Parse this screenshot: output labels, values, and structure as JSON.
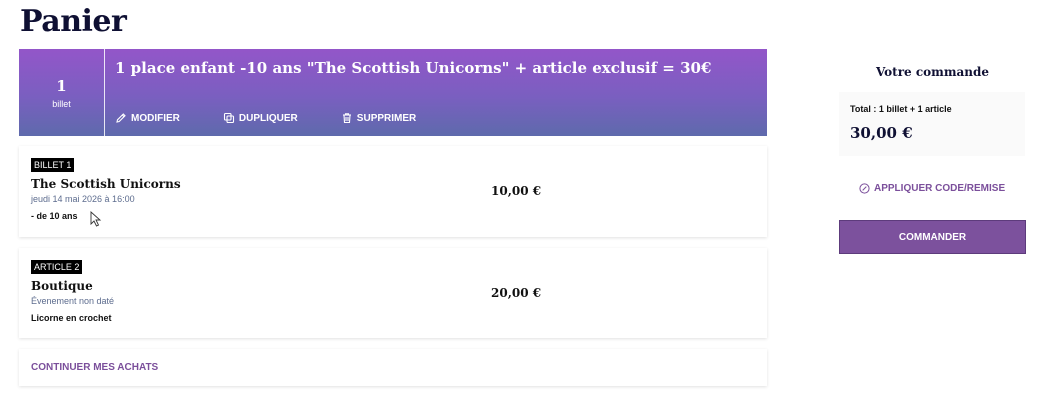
{
  "page": {
    "title": "Panier"
  },
  "cart_header": {
    "quantity": "1",
    "quantity_label": "billet",
    "title": "1 place enfant -10 ans \"The Scottish Unicorns\" + article exclusif = 30€",
    "actions": {
      "edit": "MODIFIER",
      "duplicate": "DUPLIQUER",
      "delete": "SUPPRIMER"
    },
    "gradient_colors": [
      "#9356c9",
      "#5e6aac"
    ]
  },
  "items": [
    {
      "badge": "BILLET 1",
      "name": "The Scottish Unicorns",
      "date": "jeudi 14 mai 2026 à 16:00",
      "extra": "- de 10 ans",
      "price": "10,00 €"
    },
    {
      "badge": "ARTICLE 2",
      "name": "Boutique",
      "date": "Évenement non daté",
      "extra": "Licorne en crochet",
      "price": "20,00 €"
    }
  ],
  "continue_label": "CONTINUER MES ACHATS",
  "order": {
    "title": "Votre commande",
    "total_label": "Total : 1 billet + 1 article",
    "total": "30,00 €",
    "discount_label": "APPLIQUER CODE/REMISE",
    "submit_label": "COMMANDER"
  },
  "icons": {
    "edit": "pencil-icon",
    "duplicate": "copy-icon",
    "delete": "trash-icon",
    "discount": "tag-circle-icon",
    "cursor": "mouse-cursor-icon"
  },
  "colors": {
    "accent": "#7c519d",
    "title": "#0f1033",
    "date_text": "#5d6c8e"
  }
}
